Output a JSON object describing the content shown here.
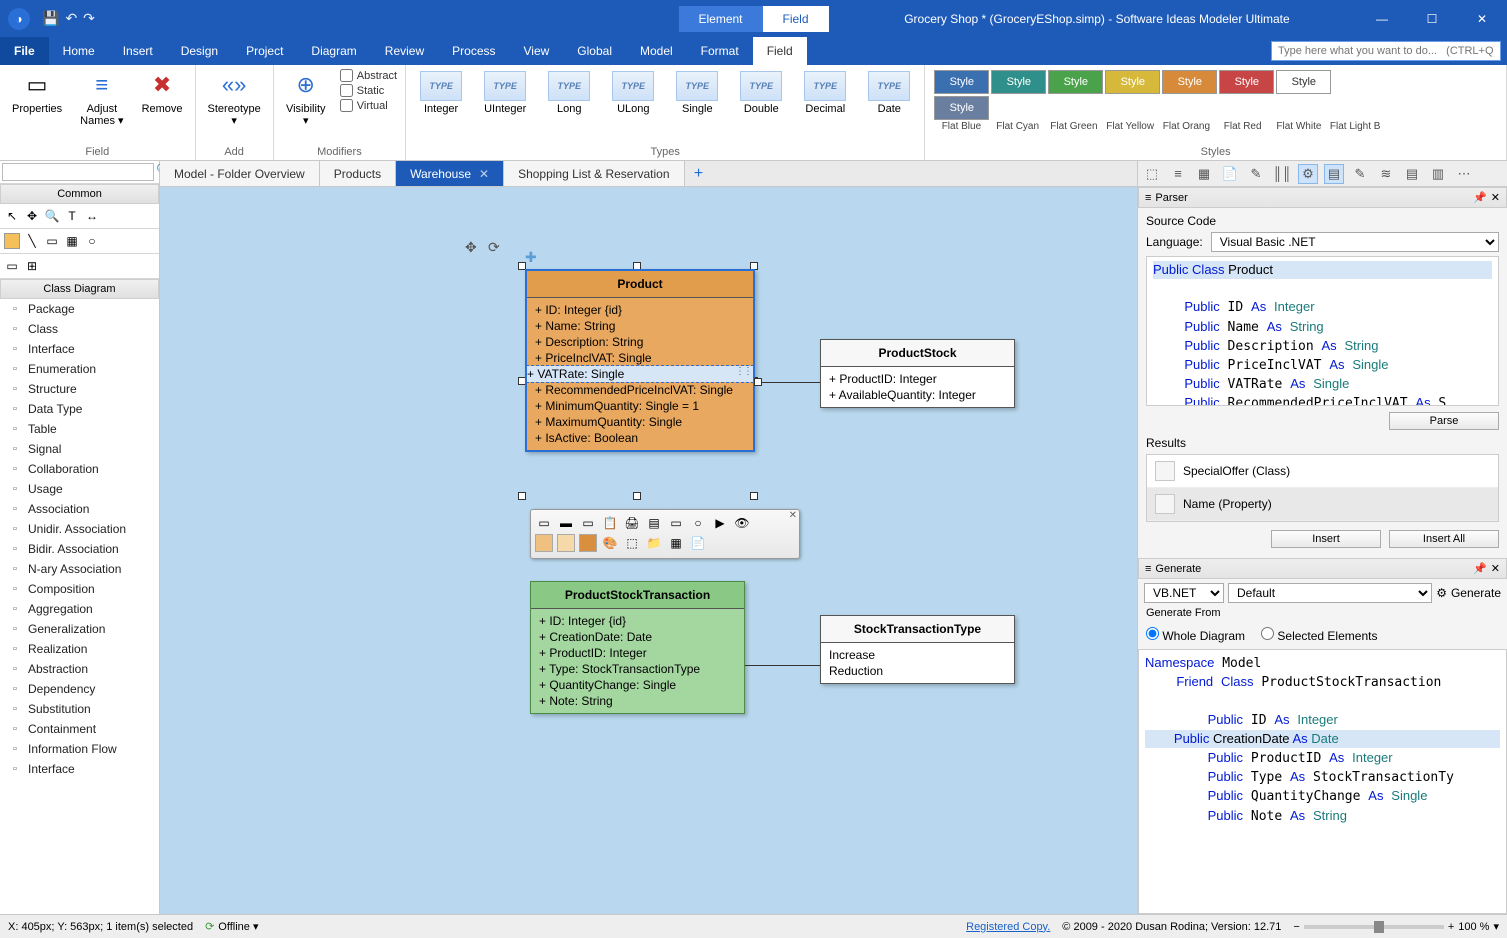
{
  "app": {
    "doctitle": "Grocery Shop * (GroceryEShop.simp) - Software Ideas Modeler Ultimate",
    "contextTabs": {
      "group": "Element",
      "active": "Field"
    },
    "searchPlaceholder": "Type here what you want to do...   (CTRL+Q)"
  },
  "menus": [
    "File",
    "Home",
    "Insert",
    "Design",
    "Project",
    "Diagram",
    "Review",
    "Process",
    "View",
    "Global",
    "Model",
    "Format",
    "Field"
  ],
  "activeMenu": "Field",
  "ribbon": {
    "groups": {
      "field": {
        "label": "Field",
        "properties": "Properties",
        "adjustNames": "Adjust\nNames ▾",
        "remove": "Remove"
      },
      "add": {
        "label": "Add",
        "stereotype": "Stereotype\n▾"
      },
      "modifiers": {
        "label": "Modifiers",
        "visibility": "Visibility\n▾",
        "abstract": "Abstract",
        "static": "Static",
        "virtual": "Virtual"
      },
      "types": {
        "label": "Types",
        "items": [
          "Integer",
          "UInteger",
          "Long",
          "ULong",
          "Single",
          "Double",
          "Decimal",
          "Date"
        ]
      },
      "styles": {
        "label": "Styles",
        "buttons": [
          {
            "label": "Style",
            "bg": "#3a6fb0"
          },
          {
            "label": "Style",
            "bg": "#2f8f8a"
          },
          {
            "label": "Style",
            "bg": "#4aa24a"
          },
          {
            "label": "Style",
            "bg": "#d6b93a"
          },
          {
            "label": "Style",
            "bg": "#d68a3a"
          },
          {
            "label": "Style",
            "bg": "#c84545"
          },
          {
            "label": "Style",
            "bg": "#ffffff",
            "fg": "#333"
          },
          {
            "label": "Style",
            "bg": "#6a7fa0"
          }
        ],
        "names": [
          "Flat Blue",
          "Flat Cyan",
          "Flat Green",
          "Flat Yellow",
          "Flat Orang",
          "Flat Red",
          "Flat White",
          "Flat Light B"
        ]
      }
    }
  },
  "leftpane": {
    "commonHeader": "Common",
    "classDiagramHeader": "Class Diagram",
    "tools": [
      "Package",
      "Class",
      "Interface",
      "Enumeration",
      "Structure",
      "Data Type",
      "Table",
      "Signal",
      "Collaboration",
      "Usage",
      "Association",
      "Unidir. Association",
      "Bidir. Association",
      "N-ary Association",
      "Composition",
      "Aggregation",
      "Generalization",
      "Realization",
      "Abstraction",
      "Dependency",
      "Substitution",
      "Containment",
      "Information Flow",
      "Interface"
    ]
  },
  "doctabs": [
    {
      "label": "Model - Folder Overview",
      "active": false
    },
    {
      "label": "Products",
      "active": false
    },
    {
      "label": "Warehouse",
      "active": true
    },
    {
      "label": "Shopping List & Reservation",
      "active": false
    }
  ],
  "diagram": {
    "product": {
      "title": "Product",
      "attrs": [
        "+ ID: Integer {id}",
        "+ Name: String",
        "+ Description: String",
        "+ PriceInclVAT: Single"
      ],
      "selectedAttr": "+ VATRate: Single",
      "attrs2": [
        "+ RecommendedPriceInclVAT: Single",
        "+ MinimumQuantity: Single = 1",
        "+ MaximumQuantity: Single",
        "+ IsActive: Boolean"
      ]
    },
    "productStock": {
      "title": "ProductStock",
      "attrs": [
        "+ ProductID: Integer",
        "+ AvailableQuantity: Integer"
      ]
    },
    "pst": {
      "title": "ProductStockTransaction",
      "attrs": [
        "+ ID: Integer {id}",
        "+ CreationDate: Date",
        "+ ProductID: Integer",
        "+ Type: StockTransactionType",
        "+ QuantityChange: Single",
        "+ Note: String"
      ]
    },
    "stt": {
      "title": "StockTransactionType",
      "attrs": [
        "Increase",
        "Reduction"
      ]
    }
  },
  "parser": {
    "header": "Parser",
    "sourceCodeLabel": "Source Code",
    "languageLabel": "Language:",
    "language": "Visual Basic .NET",
    "code": "Public Class Product\n\n    Public ID As Integer\n    Public Name As String\n    Public Description As String\n    Public PriceInclVAT As Single\n    Public VATRate As Single\n    Public RecommendedPriceInclVAT As S\n    Public MinimumQuantity As Single = ",
    "parseBtn": "Parse",
    "resultsLabel": "Results",
    "results": [
      "SpecialOffer (Class)",
      "Name (Property)"
    ],
    "insertBtn": "Insert",
    "insertAllBtn": "Insert All"
  },
  "generate": {
    "header": "Generate",
    "lang": "VB.NET",
    "template": "Default",
    "generateBtn": "Generate",
    "generateFromLabel": "Generate From",
    "wholeDiagram": "Whole Diagram",
    "selectedElements": "Selected Elements",
    "code": "Namespace Model\n    Friend Class ProductStockTransaction\n\n        Public ID As Integer\n        Public CreationDate As Date\n        Public ProductID As Integer\n        Public Type As StockTransactionTy\n        Public QuantityChange As Single\n        Public Note As String"
  },
  "status": {
    "coords": "X: 405px; Y: 563px; 1 item(s) selected",
    "offline": "Offline ▾",
    "registered": "Registered Copy.",
    "copyright": "© 2009 - 2020 Dusan Rodina; Version: 12.71",
    "zoom": "100 %"
  }
}
